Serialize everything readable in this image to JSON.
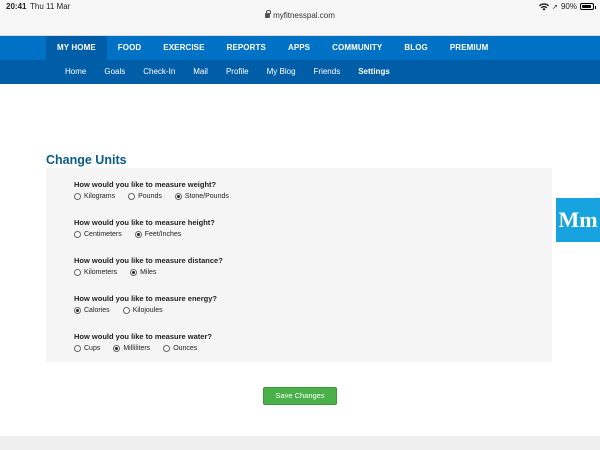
{
  "status_bar": {
    "time": "20:41",
    "date": "Thu 11 Mar",
    "battery": "90%",
    "battery_level": 0.9,
    "url": "myfitnesspal.com"
  },
  "nav_primary": [
    {
      "label": "MY HOME",
      "active": true
    },
    {
      "label": "FOOD",
      "active": false
    },
    {
      "label": "EXERCISE",
      "active": false
    },
    {
      "label": "REPORTS",
      "active": false
    },
    {
      "label": "APPS",
      "active": false
    },
    {
      "label": "COMMUNITY",
      "active": false
    },
    {
      "label": "BLOG",
      "active": false
    },
    {
      "label": "PREMIUM",
      "active": false
    }
  ],
  "nav_secondary": [
    {
      "label": "Home",
      "active": false
    },
    {
      "label": "Goals",
      "active": false
    },
    {
      "label": "Check-In",
      "active": false
    },
    {
      "label": "Mail",
      "active": false
    },
    {
      "label": "Profile",
      "active": false
    },
    {
      "label": "My Blog",
      "active": false
    },
    {
      "label": "Friends",
      "active": false
    },
    {
      "label": "Settings",
      "active": true
    }
  ],
  "ad": {
    "brand_mark": "Mm",
    "adchoices_icon": "adchoices-icon"
  },
  "page_title": "Change Units",
  "questions": [
    {
      "question": "How would you like to measure weight?",
      "options": [
        "Kilograms",
        "Pounds",
        "Stone/Pounds"
      ],
      "selected": 2
    },
    {
      "question": "How would you like to measure height?",
      "options": [
        "Centimeters",
        "Feet/Inches"
      ],
      "selected": 1
    },
    {
      "question": "How would you like to measure distance?",
      "options": [
        "Kilometers",
        "Miles"
      ],
      "selected": 1
    },
    {
      "question": "How would you like to measure energy?",
      "options": [
        "Calories",
        "Kilojoules"
      ],
      "selected": 0
    },
    {
      "question": "How would you like to measure water?",
      "options": [
        "Cups",
        "Milliliters",
        "Ounces"
      ],
      "selected": 1
    }
  ],
  "save_label": "Save Changes",
  "colors": {
    "nav_primary": "#0072c6",
    "nav_secondary": "#005ea8",
    "title": "#0a5a8a",
    "save_button": "#4ab04a"
  }
}
